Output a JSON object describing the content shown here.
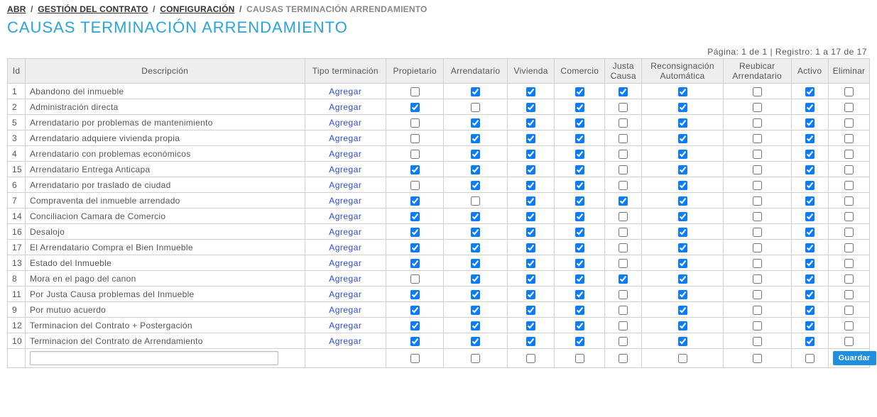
{
  "breadcrumb": {
    "seg0": "ABR",
    "seg1": "GESTIÓN DEL CONTRATO",
    "seg2": "CONFIGURACIÓN",
    "seg3": "CAUSAS TERMINACIÓN ARRENDAMIENTO"
  },
  "page_title": "CAUSAS TERMINACIÓN ARRENDAMIENTO",
  "pager_text": "Página: 1 de 1  |  Registro: 1 a 17 de 17",
  "columns": {
    "id": "Id",
    "desc": "Descripción",
    "tipo": "Tipo terminación",
    "prop": "Propietario",
    "arr": "Arrendatario",
    "viv": "Vivienda",
    "com": "Comercio",
    "justa": "Justa Causa",
    "recon": "Reconsignación Automática",
    "reub": "Reubicar Arrendatario",
    "act": "Activo",
    "elim": "Eliminar"
  },
  "agregar_label": "Agregar",
  "save_label": "Guardar",
  "rows": [
    {
      "id": "1",
      "desc": "Abandono del inmueble",
      "prop": false,
      "arr": true,
      "viv": true,
      "com": true,
      "justa": true,
      "recon": true,
      "reub": false,
      "act": true,
      "elim": false
    },
    {
      "id": "2",
      "desc": "Administración directa",
      "prop": true,
      "arr": false,
      "viv": true,
      "com": true,
      "justa": false,
      "recon": true,
      "reub": false,
      "act": true,
      "elim": false
    },
    {
      "id": "5",
      "desc": "Arrendatario por problemas de mantenimiento",
      "prop": false,
      "arr": true,
      "viv": true,
      "com": true,
      "justa": false,
      "recon": true,
      "reub": false,
      "act": true,
      "elim": false
    },
    {
      "id": "3",
      "desc": "Arrendatario adquiere vivienda propia",
      "prop": false,
      "arr": true,
      "viv": true,
      "com": true,
      "justa": false,
      "recon": true,
      "reub": false,
      "act": true,
      "elim": false
    },
    {
      "id": "4",
      "desc": "Arrendatario con problemas económicos",
      "prop": false,
      "arr": true,
      "viv": true,
      "com": true,
      "justa": false,
      "recon": true,
      "reub": false,
      "act": true,
      "elim": false
    },
    {
      "id": "15",
      "desc": "Arrendatario Entrega Anticapa",
      "prop": true,
      "arr": true,
      "viv": true,
      "com": true,
      "justa": false,
      "recon": true,
      "reub": false,
      "act": true,
      "elim": false
    },
    {
      "id": "6",
      "desc": "Arrendatario por traslado de ciudad",
      "prop": false,
      "arr": true,
      "viv": true,
      "com": true,
      "justa": false,
      "recon": true,
      "reub": false,
      "act": true,
      "elim": false
    },
    {
      "id": "7",
      "desc": "Compraventa del inmueble arrendado",
      "prop": true,
      "arr": false,
      "viv": true,
      "com": true,
      "justa": true,
      "recon": true,
      "reub": false,
      "act": true,
      "elim": false
    },
    {
      "id": "14",
      "desc": "Conciliacion Camara de Comercio",
      "prop": true,
      "arr": true,
      "viv": true,
      "com": true,
      "justa": false,
      "recon": true,
      "reub": false,
      "act": true,
      "elim": false
    },
    {
      "id": "16",
      "desc": "Desalojo",
      "prop": true,
      "arr": true,
      "viv": true,
      "com": true,
      "justa": false,
      "recon": true,
      "reub": false,
      "act": true,
      "elim": false
    },
    {
      "id": "17",
      "desc": "El Arrendatario Compra el Bien Inmueble",
      "prop": true,
      "arr": true,
      "viv": true,
      "com": true,
      "justa": false,
      "recon": true,
      "reub": false,
      "act": true,
      "elim": false
    },
    {
      "id": "13",
      "desc": "Estado del Inmueble",
      "prop": true,
      "arr": true,
      "viv": true,
      "com": true,
      "justa": false,
      "recon": true,
      "reub": false,
      "act": true,
      "elim": false
    },
    {
      "id": "8",
      "desc": "Mora en el pago del canon",
      "prop": false,
      "arr": true,
      "viv": true,
      "com": true,
      "justa": true,
      "recon": true,
      "reub": false,
      "act": true,
      "elim": false
    },
    {
      "id": "11",
      "desc": "Por Justa Causa problemas del Inmueble",
      "prop": true,
      "arr": true,
      "viv": true,
      "com": true,
      "justa": false,
      "recon": true,
      "reub": false,
      "act": true,
      "elim": false
    },
    {
      "id": "9",
      "desc": "Por mutuo acuerdo",
      "prop": true,
      "arr": true,
      "viv": true,
      "com": true,
      "justa": false,
      "recon": true,
      "reub": false,
      "act": true,
      "elim": false
    },
    {
      "id": "12",
      "desc": "Terminacion del Contrato + Postergación",
      "prop": true,
      "arr": true,
      "viv": true,
      "com": true,
      "justa": false,
      "recon": true,
      "reub": false,
      "act": true,
      "elim": false
    },
    {
      "id": "10",
      "desc": "Terminacion del Contrato de Arrendamiento",
      "prop": true,
      "arr": true,
      "viv": true,
      "com": true,
      "justa": false,
      "recon": true,
      "reub": false,
      "act": true,
      "elim": false
    }
  ],
  "new_row": {
    "desc": "",
    "prop": false,
    "arr": false,
    "viv": false,
    "com": false,
    "justa": false,
    "recon": false,
    "reub": false,
    "act": false
  }
}
